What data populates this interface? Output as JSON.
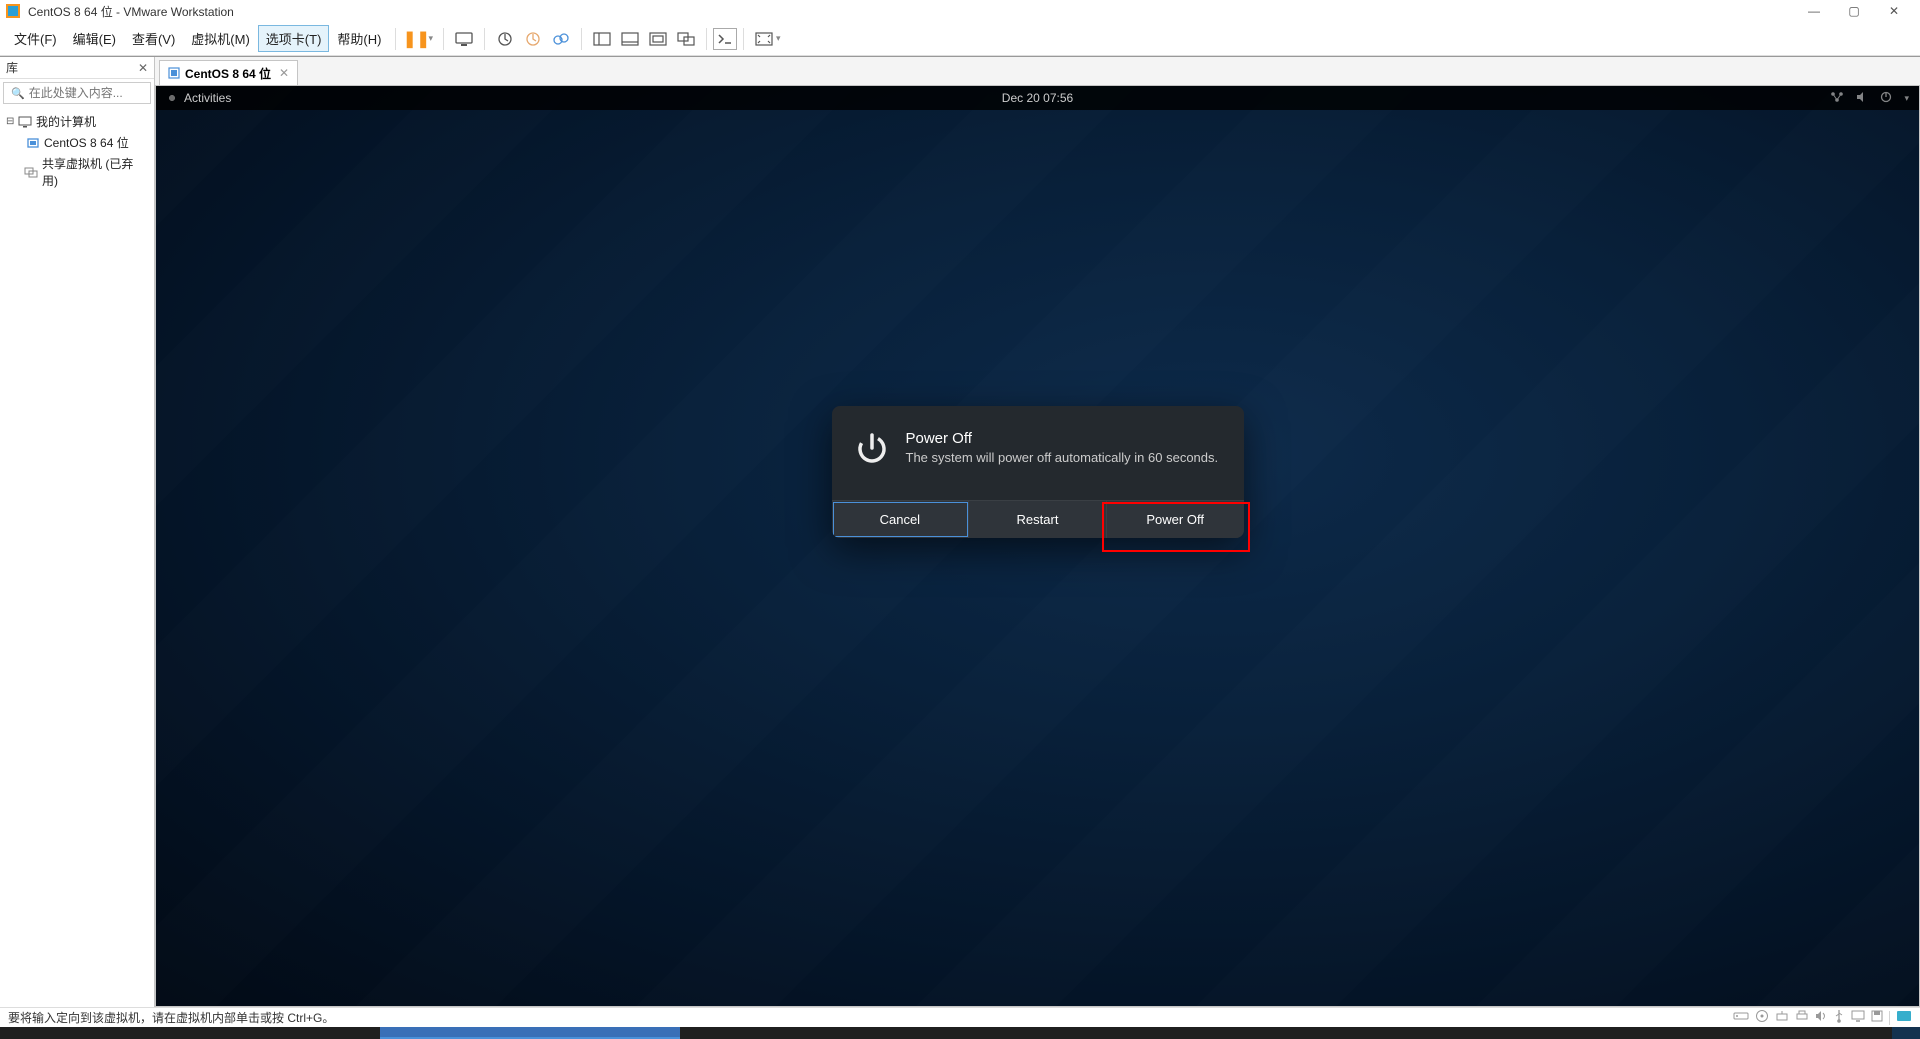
{
  "titlebar": {
    "title": "CentOS 8 64 位 - VMware Workstation"
  },
  "menubar": {
    "items": [
      {
        "label": "文件(F)"
      },
      {
        "label": "编辑(E)"
      },
      {
        "label": "查看(V)"
      },
      {
        "label": "虚拟机(M)"
      },
      {
        "label": "选项卡(T)",
        "active": true
      },
      {
        "label": "帮助(H)"
      }
    ]
  },
  "sidebar": {
    "title": "库",
    "search_placeholder": "在此处键入内容...",
    "tree": {
      "root": "我的计算机",
      "child": "CentOS 8 64 位",
      "shared": "共享虚拟机 (已弃用)"
    }
  },
  "tab": {
    "label": "CentOS 8 64 位"
  },
  "gnome": {
    "activities": "Activities",
    "datetime": "Dec 20  07:56"
  },
  "dialog": {
    "title": "Power Off",
    "message": "The system will power off automatically in 60 seconds.",
    "buttons": {
      "cancel": "Cancel",
      "restart": "Restart",
      "poweroff": "Power Off"
    }
  },
  "statusbar": {
    "message": "要将输入定向到该虚拟机，请在虚拟机内部单击或按 Ctrl+G。"
  }
}
